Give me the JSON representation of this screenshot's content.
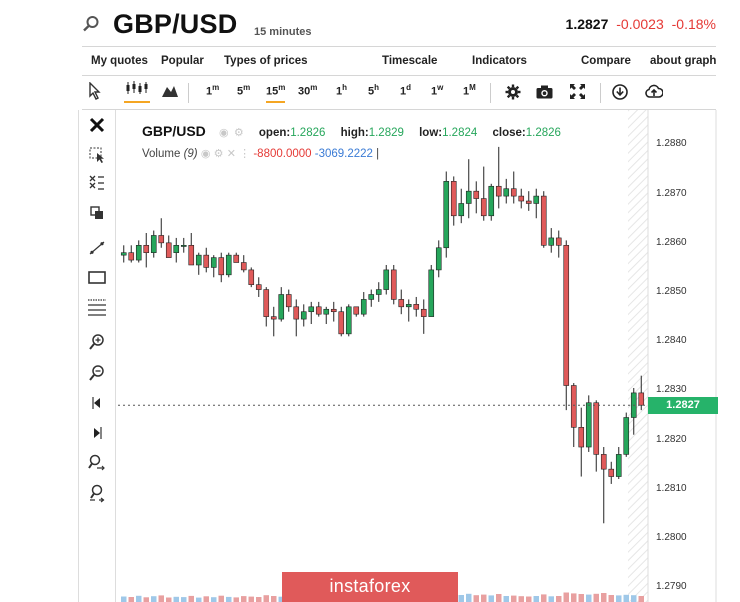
{
  "header": {
    "symbol": "GBP/USD",
    "timeframe": "15 minutes",
    "last": "1.2827",
    "change": "-0.0023",
    "change_pct": "-0.18%"
  },
  "menu": [
    "My quotes",
    "Popular",
    "Types of prices",
    "Timescale",
    "Indicators",
    "Compare",
    "about graph"
  ],
  "toolbar": {
    "intervals": [
      {
        "n": "1",
        "u": "m"
      },
      {
        "n": "5",
        "u": "m"
      },
      {
        "n": "15",
        "u": "m"
      },
      {
        "n": "30",
        "u": "m"
      },
      {
        "n": "1",
        "u": "h"
      },
      {
        "n": "5",
        "u": "h"
      },
      {
        "n": "1",
        "u": "d"
      },
      {
        "n": "1",
        "u": "w"
      },
      {
        "n": "1",
        "u": "M"
      }
    ],
    "active_interval": "15m"
  },
  "legend": {
    "symbol": "GBP/USD",
    "open_label": "open:",
    "open": "1.2826",
    "high_label": "high:",
    "high": "1.2829",
    "low_label": "low:",
    "low": "1.2824",
    "close_label": "close:",
    "close": "1.2826"
  },
  "volume_legend": {
    "label": "Volume",
    "period": "(9)",
    "v1": "-8800.0000",
    "v2": "-3069.2222",
    "bar": "|"
  },
  "price_tag": "1.2827",
  "brand": "instaforex",
  "colors": {
    "up": "#26a65b",
    "down": "#e05a5a",
    "accent": "#f5a623",
    "tag": "#26b36a"
  },
  "icons": [
    "search-icon",
    "cursor-icon",
    "candles-icon",
    "area-icon",
    "settings-icon",
    "camera-icon",
    "fullscreen-icon",
    "download-icon",
    "cloud-icon",
    "close-icon",
    "zoom-in-icon",
    "zoom-out-icon"
  ],
  "chart_data": {
    "type": "candlestick",
    "ylim": [
      1.2787,
      1.2887
    ],
    "yticks": [
      "1.2880",
      "1.2870",
      "1.2860",
      "1.2850",
      "1.2840",
      "1.2830",
      "1.2820",
      "1.2810",
      "1.2800",
      "1.2790"
    ],
    "current_price": 1.2827,
    "ohlc": [
      [
        1.28575,
        1.28595,
        1.2856,
        1.2858
      ],
      [
        1.2858,
        1.28595,
        1.2856,
        1.28565
      ],
      [
        1.28565,
        1.28605,
        1.2856,
        1.28595
      ],
      [
        1.28595,
        1.2862,
        1.2855,
        1.2858
      ],
      [
        1.2858,
        1.28625,
        1.2857,
        1.28615
      ],
      [
        1.28615,
        1.2865,
        1.2859,
        1.286
      ],
      [
        1.286,
        1.28615,
        1.2857,
        1.2857
      ],
      [
        1.2858,
        1.2861,
        1.2856,
        1.28595
      ],
      [
        1.28595,
        1.2861,
        1.2858,
        1.28595
      ],
      [
        1.28595,
        1.2862,
        1.2856,
        1.28555
      ],
      [
        1.28555,
        1.2858,
        1.28535,
        1.28575
      ],
      [
        1.28575,
        1.2859,
        1.2854,
        1.2855
      ],
      [
        1.2855,
        1.28575,
        1.2853,
        1.2857
      ],
      [
        1.2857,
        1.2858,
        1.2852,
        1.28535
      ],
      [
        1.28535,
        1.2858,
        1.2853,
        1.28575
      ],
      [
        1.28575,
        1.2858,
        1.2856,
        1.2856
      ],
      [
        1.2856,
        1.28575,
        1.2854,
        1.28545
      ],
      [
        1.28545,
        1.2855,
        1.2851,
        1.28515
      ],
      [
        1.28515,
        1.2853,
        1.2849,
        1.28505
      ],
      [
        1.28505,
        1.2851,
        1.2843,
        1.2845
      ],
      [
        1.2845,
        1.2847,
        1.2841,
        1.28445
      ],
      [
        1.28445,
        1.2851,
        1.2844,
        1.28495
      ],
      [
        1.28495,
        1.28505,
        1.2846,
        1.2847
      ],
      [
        1.2847,
        1.28485,
        1.2841,
        1.28445
      ],
      [
        1.28445,
        1.28475,
        1.2843,
        1.2846
      ],
      [
        1.2846,
        1.2848,
        1.28435,
        1.2847
      ],
      [
        1.2847,
        1.2848,
        1.2845,
        1.28455
      ],
      [
        1.28455,
        1.2847,
        1.28435,
        1.28465
      ],
      [
        1.28465,
        1.2848,
        1.2844,
        1.2846
      ],
      [
        1.2846,
        1.2847,
        1.2841,
        1.28415
      ],
      [
        1.28415,
        1.28475,
        1.2841,
        1.2847
      ],
      [
        1.2847,
        1.2847,
        1.2845,
        1.28455
      ],
      [
        1.28455,
        1.285,
        1.2845,
        1.28485
      ],
      [
        1.28485,
        1.28505,
        1.2847,
        1.28495
      ],
      [
        1.28495,
        1.2852,
        1.2848,
        1.28505
      ],
      [
        1.28505,
        1.28555,
        1.28495,
        1.28545
      ],
      [
        1.28545,
        1.28555,
        1.28475,
        1.28485
      ],
      [
        1.28485,
        1.28505,
        1.28455,
        1.2847
      ],
      [
        1.2847,
        1.28485,
        1.2844,
        1.28475
      ],
      [
        1.28475,
        1.2849,
        1.2845,
        1.28465
      ],
      [
        1.28465,
        1.28485,
        1.28415,
        1.2845
      ],
      [
        1.2845,
        1.28555,
        1.2845,
        1.28545
      ],
      [
        1.28545,
        1.28605,
        1.2853,
        1.2859
      ],
      [
        1.2859,
        1.28745,
        1.2857,
        1.28725
      ],
      [
        1.28725,
        1.28735,
        1.28635,
        1.28655
      ],
      [
        1.28655,
        1.2871,
        1.2864,
        1.2868
      ],
      [
        1.2868,
        1.2877,
        1.2865,
        1.28705
      ],
      [
        1.28705,
        1.28725,
        1.2866,
        1.2869
      ],
      [
        1.2869,
        1.28755,
        1.28645,
        1.28655
      ],
      [
        1.28655,
        1.2872,
        1.28645,
        1.28715
      ],
      [
        1.28715,
        1.28795,
        1.2867,
        1.28695
      ],
      [
        1.28695,
        1.2873,
        1.2868,
        1.2871
      ],
      [
        1.2871,
        1.28745,
        1.2868,
        1.28695
      ],
      [
        1.28695,
        1.2871,
        1.2867,
        1.28685
      ],
      [
        1.28685,
        1.28705,
        1.28665,
        1.2868
      ],
      [
        1.2868,
        1.2871,
        1.2865,
        1.28695
      ],
      [
        1.28695,
        1.28705,
        1.2859,
        1.28595
      ],
      [
        1.28595,
        1.2863,
        1.2858,
        1.2861
      ],
      [
        1.2861,
        1.28625,
        1.2857,
        1.28595
      ],
      [
        1.28595,
        1.28605,
        1.2826,
        1.2831
      ],
      [
        1.2831,
        1.28315,
        1.28185,
        1.28225
      ],
      [
        1.28225,
        1.28265,
        1.28125,
        1.28185
      ],
      [
        1.28185,
        1.2829,
        1.28175,
        1.28275
      ],
      [
        1.28275,
        1.2828,
        1.28135,
        1.2817
      ],
      [
        1.2817,
        1.28185,
        1.2803,
        1.2814
      ],
      [
        1.2814,
        1.28155,
        1.2811,
        1.28125
      ],
      [
        1.28125,
        1.28185,
        1.2812,
        1.2817
      ],
      [
        1.2817,
        1.28255,
        1.28165,
        1.28245
      ],
      [
        1.28245,
        1.28305,
        1.2821,
        1.28295
      ],
      [
        1.28295,
        1.2833,
        1.2826,
        1.2827
      ]
    ],
    "volume": [
      0.55,
      0.5,
      0.62,
      0.47,
      0.58,
      0.66,
      0.45,
      0.52,
      0.49,
      0.61,
      0.44,
      0.57,
      0.48,
      0.63,
      0.51,
      0.46,
      0.59,
      0.54,
      0.5,
      0.68,
      0.6,
      0.53,
      0.47,
      0.64,
      0.5,
      0.45,
      0.56,
      0.52,
      0.49,
      0.7,
      0.58,
      0.46,
      0.55,
      0.5,
      0.61,
      0.66,
      0.52,
      0.48,
      0.57,
      0.5,
      0.62,
      0.74,
      0.65,
      0.86,
      0.78,
      0.7,
      0.82,
      0.68,
      0.74,
      0.66,
      0.8,
      0.6,
      0.64,
      0.58,
      0.55,
      0.6,
      0.76,
      0.57,
      0.6,
      0.95,
      0.86,
      0.8,
      0.74,
      0.82,
      0.9,
      0.7,
      0.66,
      0.72,
      0.68,
      0.6
    ]
  }
}
